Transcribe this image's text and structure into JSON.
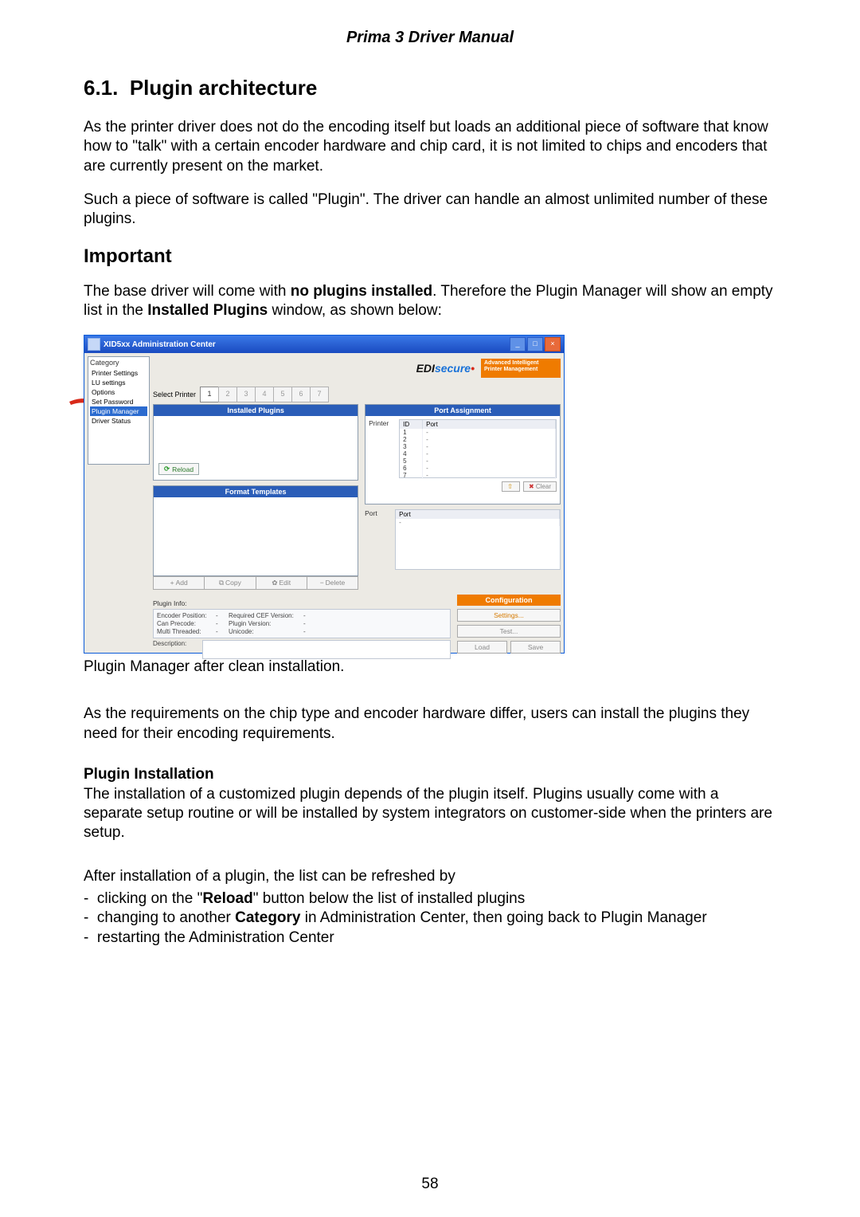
{
  "doc_title": "Prima 3 Driver Manual",
  "section_number": "6.1.",
  "section_title": "Plugin architecture",
  "para1": "As the printer driver does not do the encoding itself but loads an additional piece of software that know how to \"talk\" with a certain encoder hardware and chip card, it is not limited to chips and encoders that are currently present on the market.",
  "para2": "Such a piece of software is called \"Plugin\". The driver can handle an almost unlimited number of these plugins.",
  "important_heading": "Important",
  "para3_pre": "The base driver will come with ",
  "para3_b1": "no plugins installed",
  "para3_mid": ". Therefore the Plugin Manager will show an empty list in the ",
  "para3_b2": "Installed Plugins",
  "para3_post": " window, as shown below:",
  "caption": "Plugin Manager after clean installation.",
  "para4": "As the requirements on the chip type and encoder hardware differ, users can install the plugins they need for their encoding requirements.",
  "plugin_install_hd": "Plugin Installation",
  "para5": "The installation of a customized plugin depends of the plugin itself. Plugins usually come with a separate setup routine or will be installed by system integrators on customer-side when the printers are setup.",
  "para6": "After installation of a plugin, the list can be refreshed by",
  "bul1_pre": "clicking on the \"",
  "bul1_b": "Reload",
  "bul1_post": "\" button below the list of installed plugins",
  "bul2_pre": "changing to another ",
  "bul2_b": "Category",
  "bul2_post": " in Administration Center, then going back to Plugin Manager",
  "bul3": "restarting the Administration Center",
  "page_number": "58",
  "win": {
    "title": "XID5xx Administration Center",
    "brand_pre": "EDI",
    "brand_mid": "secure",
    "brand_dot": "•",
    "adbox_l1": "Advanced Intelligent",
    "adbox_l2": "Printer Management",
    "category_label": "Category",
    "categories": [
      "Printer Settings",
      "LU settings",
      "Options",
      "Set Password",
      "Plugin Manager",
      "Driver Status"
    ],
    "select_printer": "Select Printer",
    "tabs": [
      "1",
      "2",
      "3",
      "4",
      "5",
      "6",
      "7"
    ],
    "installed_hd": "Installed Plugins",
    "reload": "Reload",
    "format_hd": "Format Templates",
    "btns": {
      "add": "Add",
      "copy": "Copy",
      "edit": "Edit",
      "del": "Delete"
    },
    "port_hd": "Port Assignment",
    "printer_lbl": "Printer",
    "port_lbl": "Port",
    "th_id": "ID",
    "th_port": "Port",
    "rows": [
      [
        "1",
        "-"
      ],
      [
        "2",
        "-"
      ],
      [
        "3",
        "-"
      ],
      [
        "4",
        "-"
      ],
      [
        "5",
        "-"
      ],
      [
        "6",
        "-"
      ],
      [
        "7",
        "-"
      ]
    ],
    "clear": "Clear",
    "port_rows": [
      [
        "",
        ""
      ],
      [
        "-",
        ""
      ]
    ],
    "plugin_info_hd": "Plugin Info:",
    "pi": {
      "ep": "Encoder Position:",
      "cp": "Can Precode:",
      "mt": "Multi Threaded:",
      "rcv": "Required CEF Version:",
      "pv": "Plugin Version:",
      "uc": "Unicode:"
    },
    "desc": "Description:",
    "config_hd": "Configuration",
    "settings": "Settings...",
    "test": "Test...",
    "load": "Load",
    "save": "Save"
  }
}
